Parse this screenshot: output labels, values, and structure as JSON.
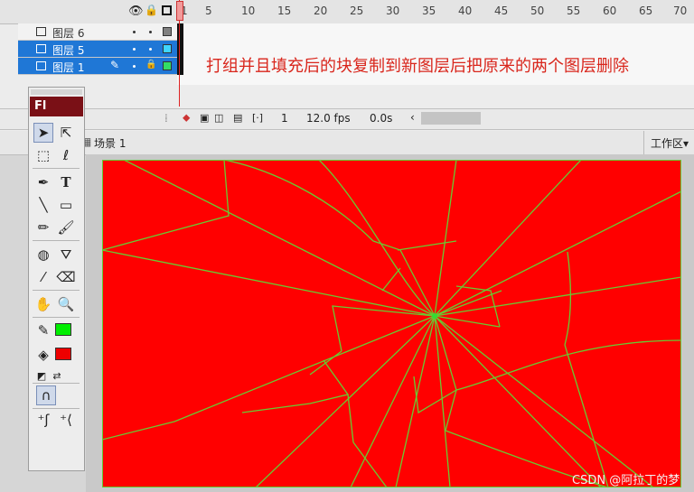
{
  "timeline": {
    "frame_ticks": [
      "1",
      "5",
      "10",
      "15",
      "20",
      "25",
      "30",
      "35",
      "40",
      "45",
      "50",
      "55",
      "60",
      "65",
      "70"
    ],
    "layers": [
      {
        "name": "图层 6",
        "selected": false,
        "color": "#808080"
      },
      {
        "name": "图层 5",
        "selected": true,
        "color": "#3fd5ff"
      },
      {
        "name": "图层 1",
        "selected": true,
        "color": "#33dd66"
      }
    ],
    "status": {
      "frame": "1",
      "fps": "12.0 fps",
      "time": "0.0s"
    }
  },
  "annotation": "打组并且填充后的块复制到新图层后把原来的两个图层删除",
  "scene": {
    "name": "场景 1",
    "workspace": "工作区▾"
  },
  "tools": {
    "logo": "Fl",
    "text_tool": "T",
    "stroke_color": "#00ee00",
    "fill_color": "#ee0000"
  },
  "stage": {
    "fill": "#ff0000",
    "line_color": "#66cc33"
  },
  "watermark": "CSDN @阿拉丁的梦"
}
